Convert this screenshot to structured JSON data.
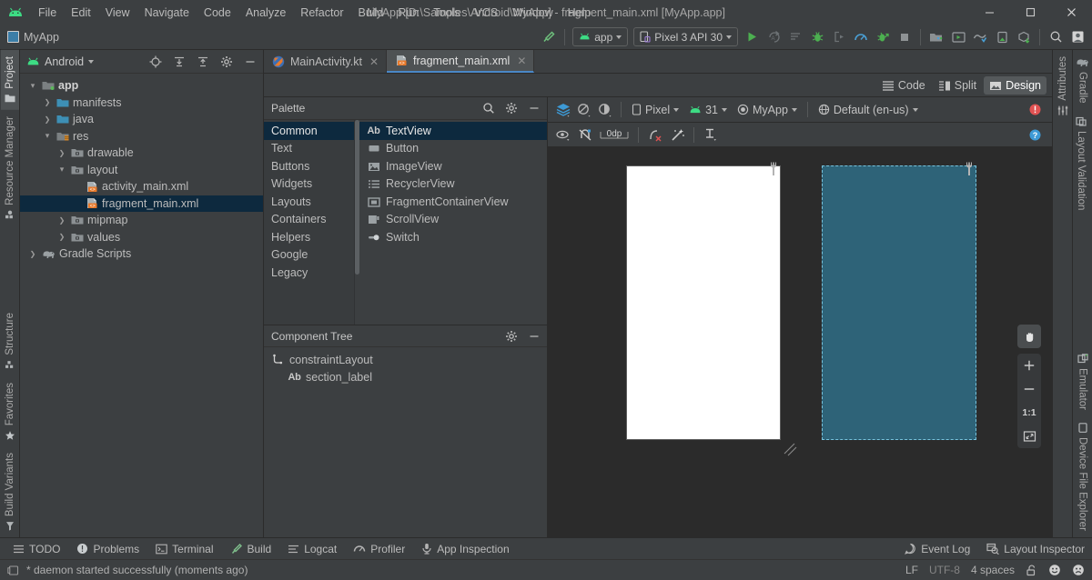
{
  "window": {
    "title": "MyApp [D:\\Samples\\Android\\MyApp] - fragment_main.xml [MyApp.app]",
    "minimize": "—",
    "maximize": "□",
    "close": "✕",
    "accent": "#4a88c7",
    "bg": "#3c3f41",
    "canvas_bg": "#2b2b2b"
  },
  "menubar": {
    "logo": "android-logo-icon",
    "items": [
      {
        "label": "File"
      },
      {
        "label": "Edit"
      },
      {
        "label": "View"
      },
      {
        "label": "Navigate"
      },
      {
        "label": "Code"
      },
      {
        "label": "Analyze"
      },
      {
        "label": "Refactor"
      },
      {
        "label": "Build"
      },
      {
        "label": "Run"
      },
      {
        "label": "Tools"
      },
      {
        "label": "VCS"
      },
      {
        "label": "Window"
      },
      {
        "label": "Help"
      }
    ]
  },
  "toolbar": {
    "breadcrumb": "MyApp",
    "build_icon": "hammer-icon",
    "run_config": {
      "label": "app",
      "icon": "android-head-icon"
    },
    "device": {
      "label": "Pixel 3 API 30",
      "icon": "phone-icon"
    },
    "actions": [
      {
        "name": "run-button",
        "icon": "play-icon"
      },
      {
        "name": "apply-changes-button",
        "icon": "apply-changes-icon"
      },
      {
        "name": "apply-code-changes-button",
        "icon": "apply-code-icon"
      },
      {
        "name": "debug-button",
        "icon": "bug-icon"
      },
      {
        "name": "attach-debugger-button",
        "icon": "attach-debugger-icon"
      },
      {
        "name": "profile-button",
        "icon": "profiler-gauge-icon"
      },
      {
        "name": "run-with-coverage-button",
        "icon": "bug-arrow-icon"
      },
      {
        "name": "stop-button",
        "icon": "stop-square-icon"
      }
    ],
    "right_actions": [
      {
        "name": "sdk-manager-button",
        "icon": "sdk-manager-icon"
      },
      {
        "name": "avd-manager-button",
        "icon": "avd-manager-icon"
      },
      {
        "name": "sync-gradle-button",
        "icon": "gradle-sync-icon"
      },
      {
        "name": "layout-inspector-button",
        "icon": "device-inspector-icon"
      },
      {
        "name": "profile-or-debug-apk-button",
        "icon": "apk-download-icon"
      },
      {
        "name": "search-everywhere-button",
        "icon": "search-icon"
      },
      {
        "name": "account-button",
        "icon": "account-avatar-icon"
      }
    ]
  },
  "left_rail": {
    "top": [
      {
        "label": "Project",
        "icon": "project-folder-icon",
        "selected": true
      },
      {
        "label": "Resource Manager",
        "icon": "resource-manager-icon",
        "selected": false
      }
    ],
    "bottom": [
      {
        "label": "Structure",
        "icon": "structure-icon"
      },
      {
        "label": "Favorites",
        "icon": "star-icon"
      },
      {
        "label": "Build Variants",
        "icon": "build-variants-icon"
      }
    ]
  },
  "right_rail": {
    "top": [
      {
        "label": "Gradle",
        "icon": "gradle-elephant-icon"
      },
      {
        "label": "Layout Validation",
        "icon": "layout-validation-icon"
      }
    ],
    "bottom": [
      {
        "label": "Emulator",
        "icon": "emulator-icon"
      },
      {
        "label": "Device File Explorer",
        "icon": "device-file-explorer-icon"
      }
    ],
    "attributes_tab": {
      "label": "Attributes",
      "icon": "sliders-icon"
    }
  },
  "project_panel": {
    "title": "Android",
    "title_icon": "android-head-icon",
    "header_actions": [
      {
        "name": "select-opened-file-button",
        "icon": "crosshair-target-icon"
      },
      {
        "name": "expand-all-button",
        "icon": "expand-all-icon"
      },
      {
        "name": "collapse-all-button",
        "icon": "collapse-all-icon"
      },
      {
        "name": "project-settings-button",
        "icon": "gear-icon"
      },
      {
        "name": "hide-panel-button",
        "icon": "minus-icon"
      }
    ],
    "tree": [
      {
        "label": "app",
        "indent": 0,
        "arrow": "v",
        "icon": "module-folder-icon",
        "bold": true,
        "selected": false
      },
      {
        "label": "manifests",
        "indent": 1,
        "arrow": ">",
        "icon": "blue-folder-icon",
        "bold": false,
        "selected": false
      },
      {
        "label": "java",
        "indent": 1,
        "arrow": ">",
        "icon": "blue-folder-icon",
        "bold": false,
        "selected": false
      },
      {
        "label": "res",
        "indent": 1,
        "arrow": "v",
        "icon": "res-folder-icon",
        "bold": false,
        "selected": false
      },
      {
        "label": "drawable",
        "indent": 2,
        "arrow": ">",
        "icon": "gray-folder-icon",
        "bold": false,
        "selected": false
      },
      {
        "label": "layout",
        "indent": 2,
        "arrow": "v",
        "icon": "gray-folder-icon",
        "bold": false,
        "selected": false
      },
      {
        "label": "activity_main.xml",
        "indent": 3,
        "arrow": "",
        "icon": "layout-xml-icon",
        "bold": false,
        "selected": false
      },
      {
        "label": "fragment_main.xml",
        "indent": 3,
        "arrow": "",
        "icon": "layout-xml-icon",
        "bold": false,
        "selected": true
      },
      {
        "label": "mipmap",
        "indent": 2,
        "arrow": ">",
        "icon": "gray-folder-icon",
        "bold": false,
        "selected": false
      },
      {
        "label": "values",
        "indent": 2,
        "arrow": ">",
        "icon": "gray-folder-icon",
        "bold": false,
        "selected": false
      },
      {
        "label": "Gradle Scripts",
        "indent": 0,
        "arrow": ">",
        "icon": "gradle-elephant-icon",
        "bold": false,
        "selected": false
      }
    ]
  },
  "editor_tabs": [
    {
      "label": "MainActivity.kt",
      "icon": "kotlin-icon",
      "active": false,
      "close": "✕"
    },
    {
      "label": "fragment_main.xml",
      "icon": "layout-xml-icon",
      "active": true,
      "close": "✕"
    }
  ],
  "view_modes": [
    {
      "label": "Code",
      "icon": "code-lines-icon",
      "selected": false
    },
    {
      "label": "Split",
      "icon": "split-view-icon",
      "selected": false
    },
    {
      "label": "Design",
      "icon": "design-view-icon",
      "selected": true
    }
  ],
  "palette": {
    "title": "Palette",
    "actions": [
      {
        "name": "palette-search-button",
        "icon": "search-icon"
      },
      {
        "name": "palette-settings-button",
        "icon": "gear-icon"
      },
      {
        "name": "palette-hide-button",
        "icon": "minus-icon"
      }
    ],
    "categories": [
      {
        "label": "Common",
        "selected": true
      },
      {
        "label": "Text",
        "selected": false
      },
      {
        "label": "Buttons",
        "selected": false
      },
      {
        "label": "Widgets",
        "selected": false
      },
      {
        "label": "Layouts",
        "selected": false
      },
      {
        "label": "Containers",
        "selected": false
      },
      {
        "label": "Helpers",
        "selected": false
      },
      {
        "label": "Google",
        "selected": false
      },
      {
        "label": "Legacy",
        "selected": false
      }
    ],
    "items": [
      {
        "label": "TextView",
        "icon": "textview-ab-icon",
        "selected": true
      },
      {
        "label": "Button",
        "icon": "button-icon",
        "selected": false
      },
      {
        "label": "ImageView",
        "icon": "imageview-icon",
        "selected": false
      },
      {
        "label": "RecyclerView",
        "icon": "recyclerview-icon",
        "selected": false
      },
      {
        "label": "FragmentContainerView",
        "icon": "fragment-container-icon",
        "selected": false
      },
      {
        "label": "ScrollView",
        "icon": "scrollview-icon",
        "selected": false
      },
      {
        "label": "Switch",
        "icon": "switch-icon",
        "selected": false
      }
    ]
  },
  "component_tree": {
    "title": "Component Tree",
    "actions": [
      {
        "name": "component-tree-settings-button",
        "icon": "gear-icon"
      },
      {
        "name": "component-tree-hide-button",
        "icon": "minus-icon"
      }
    ],
    "nodes": [
      {
        "label": "constraintLayout",
        "icon": "constraint-layout-icon",
        "indent": 0
      },
      {
        "label": "section_label",
        "icon": "textview-ab-icon",
        "indent": 1
      }
    ]
  },
  "surface_toolbar": {
    "left_icons": [
      {
        "name": "design-mode-button",
        "icon": "layers-stack-icon"
      },
      {
        "name": "orientation-button",
        "icon": "rotate-device-icon"
      },
      {
        "name": "theme-button",
        "icon": "theme-circle-icon"
      }
    ],
    "device_select": {
      "label": "Pixel",
      "icon": "phone-icon"
    },
    "api_select": {
      "label": "31",
      "icon": "android-head-icon"
    },
    "theme_select": {
      "label": "MyApp",
      "icon": "theme-circle-icon"
    },
    "locale_select": {
      "label": "Default (en-us)",
      "icon": "globe-icon"
    },
    "issue_badge": {
      "name": "issue-notification-icon",
      "icon": "error-circle-icon",
      "color": "#e05252"
    }
  },
  "constraint_toolbar": {
    "items": [
      {
        "name": "show-constraints-button",
        "icon": "eye-icon"
      },
      {
        "name": "autoconnect-button",
        "icon": "magnet-off-icon"
      },
      {
        "name": "default-margin-button",
        "label": "0dp"
      },
      {
        "name": "clear-constraints-button",
        "icon": "clear-constraints-icon"
      },
      {
        "name": "infer-constraints-button",
        "icon": "magic-wand-icon"
      },
      {
        "name": "guidelines-button",
        "icon": "guideline-icon"
      }
    ],
    "help": {
      "name": "help-button",
      "icon": "help-circle-icon"
    }
  },
  "canvas": {
    "previews": [
      {
        "name": "design-preview",
        "wrench_icon": "wrench-icon",
        "fill": "#ffffff",
        "selected": false
      },
      {
        "name": "blueprint-preview",
        "wrench_icon": "wrench-icon",
        "fill": "#2e6378",
        "selected": true
      }
    ],
    "zoom_controls": [
      {
        "name": "pan-tool-button",
        "icon": "hand-icon",
        "label": "",
        "active": true
      },
      {
        "name": "zoom-in-button",
        "icon": "plus-icon",
        "label": "+",
        "active": false
      },
      {
        "name": "zoom-out-button",
        "icon": "minus-icon",
        "label": "−",
        "active": false
      },
      {
        "name": "zoom-actual-size-button",
        "icon": "one-to-one-icon",
        "label": "1:1",
        "active": false
      },
      {
        "name": "zoom-to-fit-button",
        "icon": "zoom-fit-icon",
        "label": "",
        "active": false
      }
    ]
  },
  "bottom_bar": {
    "items": [
      {
        "label": "TODO",
        "icon": "todo-list-icon"
      },
      {
        "label": "Problems",
        "icon": "problems-icon"
      },
      {
        "label": "Terminal",
        "icon": "terminal-icon"
      },
      {
        "label": "Build",
        "icon": "hammer-icon"
      },
      {
        "label": "Logcat",
        "icon": "logcat-icon"
      },
      {
        "label": "Profiler",
        "icon": "profiler-gauge-icon"
      },
      {
        "label": "App Inspection",
        "icon": "app-inspection-icon"
      }
    ],
    "right_items": [
      {
        "label": "Event Log",
        "icon": "event-log-icon"
      },
      {
        "label": "Layout Inspector",
        "icon": "layout-inspector-icon"
      }
    ]
  },
  "status_bar": {
    "icon": "console-icon",
    "message": "* daemon started successfully (moments ago)",
    "line_separator": "LF",
    "encoding": "UTF-8",
    "indent": "4 spaces",
    "lock_icon": "unlocked-padlock-icon",
    "happy_icon": "smiley-happy-icon",
    "sad_icon": "smiley-sad-icon"
  }
}
